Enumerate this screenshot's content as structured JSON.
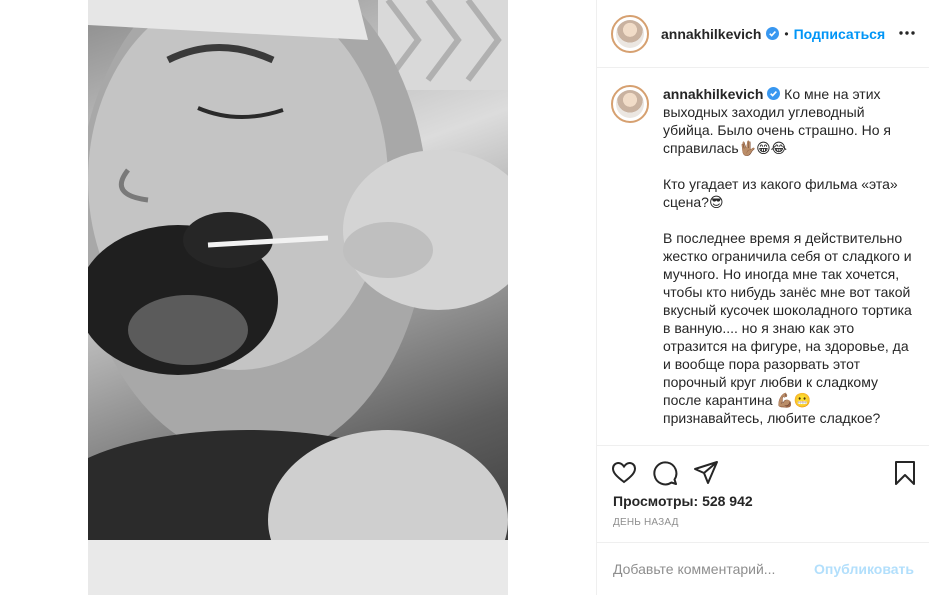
{
  "post": {
    "username": "annakhilkevich",
    "follow_label": "Подписаться",
    "separator": "•",
    "caption_username": "annakhilkevich",
    "caption": "Ко мне на этих выходных заходил углеводный убийца. Было очень страшно. Но я справилась🖖🏽😁😂\n\nКто угадает из какого фильма «эта» сцена?😎\n\nВ последнее время я действительно жестко ограничила себя от сладкого и мучного. Но иногда мне так хочется, чтобы кто нибудь занёс мне вот такой вкусный кусочек шоколадного тортика в ванную.... но я знаю как это отразится на фигуре, на здоровье, да и вообще пора разорвать этот порочный круг любви к сладкому после карантина 💪🏽😬 признавайтесь, любите сладкое?",
    "views_label": "Просмотры:",
    "views_count": "528 942",
    "time_ago": "ДЕНЬ НАЗАД"
  },
  "comment_box": {
    "placeholder": "Добавьте комментарий...",
    "publish_label": "Опубликовать"
  },
  "icons": {
    "verified": "verified-badge-icon",
    "more": "more-options-icon",
    "like": "heart-icon",
    "comment": "comment-bubble-icon",
    "share": "paper-plane-icon",
    "save": "bookmark-icon"
  },
  "colors": {
    "accent": "#0095f6",
    "publish_disabled": "#b2dffc",
    "muted": "#8e8e8e",
    "border": "#efefef"
  }
}
